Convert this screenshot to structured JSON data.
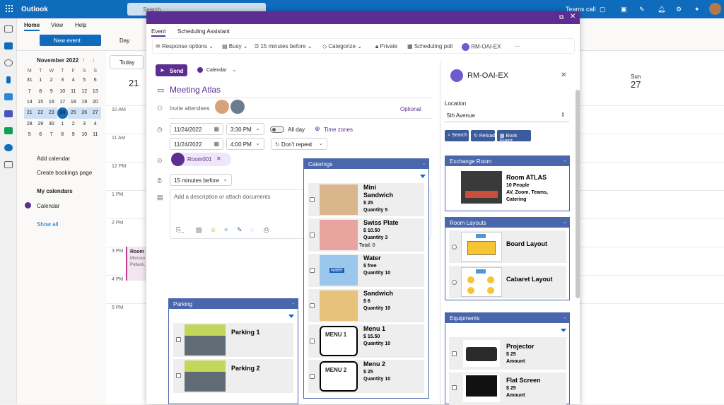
{
  "app": {
    "name": "Outlook",
    "search_placeholder": "Search",
    "teams_call": "Teams call"
  },
  "ribbon": {
    "tab_home": "Home",
    "tab_view": "View",
    "tab_help": "Help",
    "new_event": "New event",
    "day": "Day",
    "today": "Today"
  },
  "mini_calendar": {
    "month": "November 2022",
    "weekdays": [
      "M",
      "T",
      "W",
      "T",
      "F",
      "S",
      "S"
    ],
    "weeks": [
      [
        "31",
        "1",
        "2",
        "3",
        "4",
        "5",
        "6"
      ],
      [
        "7",
        "8",
        "9",
        "10",
        "11",
        "12",
        "13"
      ],
      [
        "14",
        "15",
        "16",
        "17",
        "18",
        "19",
        "20"
      ],
      [
        "21",
        "22",
        "23",
        "24",
        "25",
        "26",
        "27"
      ],
      [
        "28",
        "29",
        "30",
        "1",
        "2",
        "3",
        "4"
      ],
      [
        "5",
        "6",
        "7",
        "8",
        "9",
        "10",
        "11"
      ]
    ],
    "today": "24"
  },
  "left_nav": {
    "add_calendar": "Add calendar",
    "create_bookings": "Create bookings page",
    "my_calendars": "My calendars",
    "calendar": "Calendar",
    "show_all": "Show all"
  },
  "grid": {
    "day_21": "21",
    "day_27_name": "Sun",
    "day_27": "27",
    "times": [
      "10 AM",
      "11 AM",
      "12 PM",
      "1 PM",
      "2 PM",
      "3 PM",
      "4 PM",
      "5 PM"
    ],
    "event_title": "Room",
    "event_line1": "Microso",
    "event_line2": "Pollack,"
  },
  "modal": {
    "tab_event": "Event",
    "tab_scheduling": "Scheduling Assistant",
    "toolbar": {
      "response": "Response options",
      "busy": "Busy",
      "reminder": "15 minutes before",
      "categorize": "Categorize",
      "private": "Private",
      "poll": "Scheduling poll",
      "addin": "RM-OAI-EX",
      "more": "···"
    },
    "send": "Send",
    "calendar": "Calendar",
    "title": "Meeting Atlas",
    "invite": "Invite attendees",
    "optional": "Optional",
    "start_date": "11/24/2022",
    "start_time": "3:30 PM",
    "all_day": "All day",
    "time_zones": "Time zones",
    "end_date": "11/24/2022",
    "end_time": "4:00 PM",
    "repeat": "Don't repeat",
    "room": "Room001",
    "reminder": "15 minutes before",
    "description": "Add a description or attach documents"
  },
  "caterings": {
    "title": "Caterings",
    "items": [
      {
        "name1": "Mini",
        "name2": "Sandwich",
        "price": "$ 25",
        "qty": "Quantity 5",
        "total": ""
      },
      {
        "name1": "Swiss Plate",
        "name2": "",
        "price": "$ 10.50",
        "qty": "Quantity 3",
        "total": "Total: 0"
      },
      {
        "name1": "Water",
        "name2": "",
        "price": "$ free",
        "qty": "Quantity 10",
        "total": ""
      },
      {
        "name1": "Sandwich",
        "name2": "",
        "price": "$ 6",
        "qty": "Quantity 10",
        "total": ""
      },
      {
        "name1": "Menu 1",
        "name2": "",
        "price": "$ 15.50",
        "qty": "Quantity 10",
        "total": ""
      },
      {
        "name1": "Menu 2",
        "name2": "",
        "price": "$ 25",
        "qty": "Quantity 10",
        "total": ""
      }
    ],
    "menu1_label": "MENU 1",
    "menu2_label": "MENU 2",
    "water_label": "water"
  },
  "parking": {
    "title": "Parking",
    "items": [
      {
        "name": "Parking 1"
      },
      {
        "name": "Parking 2"
      }
    ]
  },
  "panel": {
    "title": "RM-OAI-EX",
    "location_label": "Location",
    "location_value": "5th Avenue",
    "search": "Search",
    "reload": "Reload",
    "book": "Book Event",
    "exchange_title": "Exchange Room",
    "room_name": "Room ATLAS",
    "room_people": "10 People",
    "room_features": "AV, Zoom, Teams,",
    "room_features2": "Catering",
    "layouts_title": "Room Layouts",
    "layouts": [
      {
        "name": "Board Layout"
      },
      {
        "name": "Cabaret Layout"
      }
    ],
    "equip_title": "Equipments",
    "equipment": [
      {
        "name": "Projector",
        "price": "$ 25",
        "amount": "Amount"
      },
      {
        "name": "Flat Screen",
        "price": "$ 25",
        "amount": "Amount"
      }
    ]
  },
  "colors": {
    "accent": "#0f6cbd",
    "modal": "#5c2e91",
    "widget": "#4a66ac"
  }
}
